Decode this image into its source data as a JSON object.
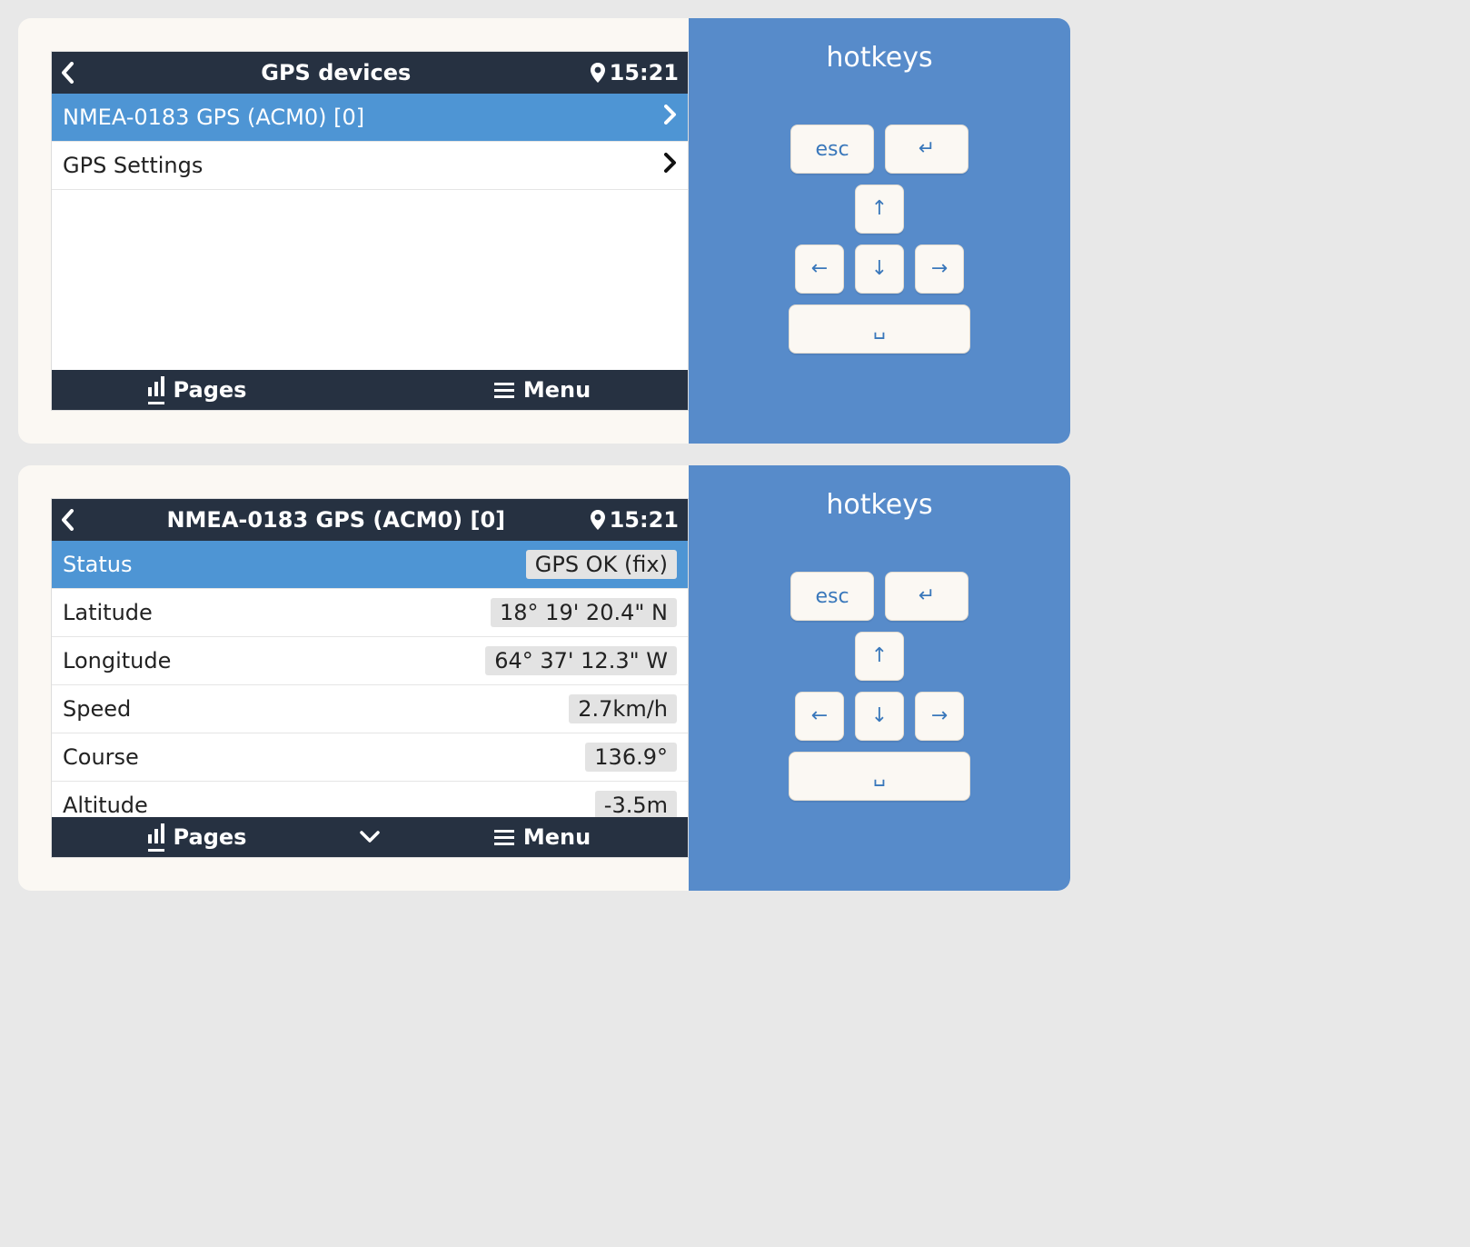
{
  "hotkeys": {
    "title": "hotkeys",
    "esc_label": "esc",
    "enter_glyph": "↵",
    "up_glyph": "↑",
    "down_glyph": "↓",
    "left_glyph": "←",
    "right_glyph": "→",
    "space_glyph": "␣"
  },
  "screen1": {
    "title": "GPS devices",
    "clock": "15:21",
    "rows": [
      {
        "label": "NMEA-0183 GPS (ACM0) [0]",
        "selected": true,
        "hasChevron": true
      },
      {
        "label": "GPS Settings",
        "selected": false,
        "hasChevron": true
      }
    ],
    "bottombar": {
      "pages_label": "Pages",
      "menu_label": "Menu",
      "show_chevron": false
    }
  },
  "screen2": {
    "title": "NMEA-0183 GPS (ACM0) [0]",
    "clock": "15:21",
    "rows": [
      {
        "label": "Status",
        "value": "GPS OK (fix)",
        "selected": true
      },
      {
        "label": "Latitude",
        "value": "18° 19' 20.4\" N",
        "selected": false
      },
      {
        "label": "Longitude",
        "value": "64° 37' 12.3\" W",
        "selected": false
      },
      {
        "label": "Speed",
        "value": "2.7km/h",
        "selected": false
      },
      {
        "label": "Course",
        "value": "136.9°",
        "selected": false
      },
      {
        "label": "Altitude",
        "value": "-3.5m",
        "selected": false
      }
    ],
    "bottombar": {
      "pages_label": "Pages",
      "menu_label": "Menu",
      "show_chevron": true
    }
  }
}
